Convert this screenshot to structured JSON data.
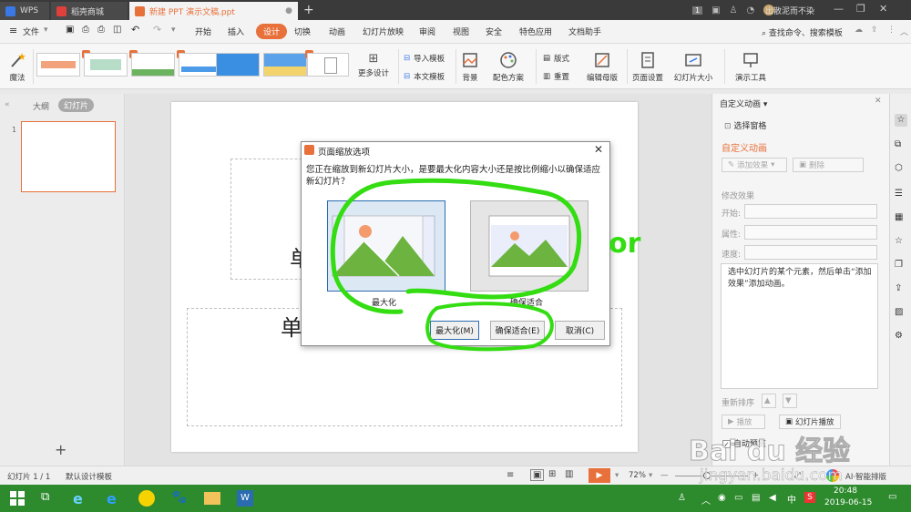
{
  "titlebar": {
    "tabs": [
      "WPS",
      "稻壳商城",
      "新建 PPT 演示文稿.ppt"
    ],
    "badge": "1",
    "user": "出散泥而不染"
  },
  "menu": {
    "file": "文件",
    "items": [
      "开始",
      "插入",
      "设计",
      "切换",
      "动画",
      "幻灯片放映",
      "审阅",
      "视图",
      "安全",
      "特色应用",
      "文档助手"
    ],
    "search": "查找命令、搜索模板"
  },
  "ribbon": {
    "magic": "魔法",
    "more_design": "更多设计",
    "import_template": "导入模板",
    "text_template": "本文模板",
    "background": "背景",
    "color_scheme": "配色方案",
    "layout": "版式",
    "reset": "重置",
    "edit_master": "编辑母版",
    "page_setup": "页面设置",
    "slide_size": "幻灯片大小",
    "presenter_tools": "演示工具"
  },
  "leftpane": {
    "tab_outline": "大纲",
    "tab_slides": "幻灯片",
    "slide_number": "1",
    "add": "+"
  },
  "slide": {
    "title_char": "单",
    "subtitle_char": "单"
  },
  "rightpane": {
    "header": "自定义动画",
    "select_pane": "选择窗格",
    "section_title": "自定义动画",
    "add_effect": "添加效果",
    "delete": "删除",
    "modify_effect": "修改效果",
    "start_label": "开始:",
    "property_label": "属性:",
    "speed_label": "速度:",
    "hint": "选中幻灯片的某个元素，然后单击“添加效果”添加动画。",
    "reorder": "重新排序",
    "play": "播放",
    "slideshow": "幻灯片播放",
    "autopreview": "自动预览"
  },
  "statusbar": {
    "slide_info": "幻灯片 1 / 1",
    "template": "默认设计模板",
    "zoom": "72%",
    "ai_layout": "AI·智能排版"
  },
  "dialog": {
    "title": "页面缩放选项",
    "message": "您正在缩放到新幻灯片大小，是要最大化内容大小还是按比例缩小以确保适应新幻灯片？",
    "option_max": "最大化",
    "option_fit": "确保适合",
    "btn_max": "最大化(M)",
    "btn_fit": "确保适合(E)",
    "btn_cancel": "取消(C)"
  },
  "annotation": {
    "text": "or"
  },
  "taskbar": {
    "time": "20:48",
    "date": "2019-06-15",
    "ime": "中"
  },
  "watermark": {
    "brand": "Bai du 经验",
    "url": "jingyan.baidu.com"
  },
  "colors": {
    "accent": "#e8703a",
    "selected_border": "#2b6cb0",
    "highlight_marker": "#33dd11",
    "taskbar": "#2d8a2d"
  }
}
